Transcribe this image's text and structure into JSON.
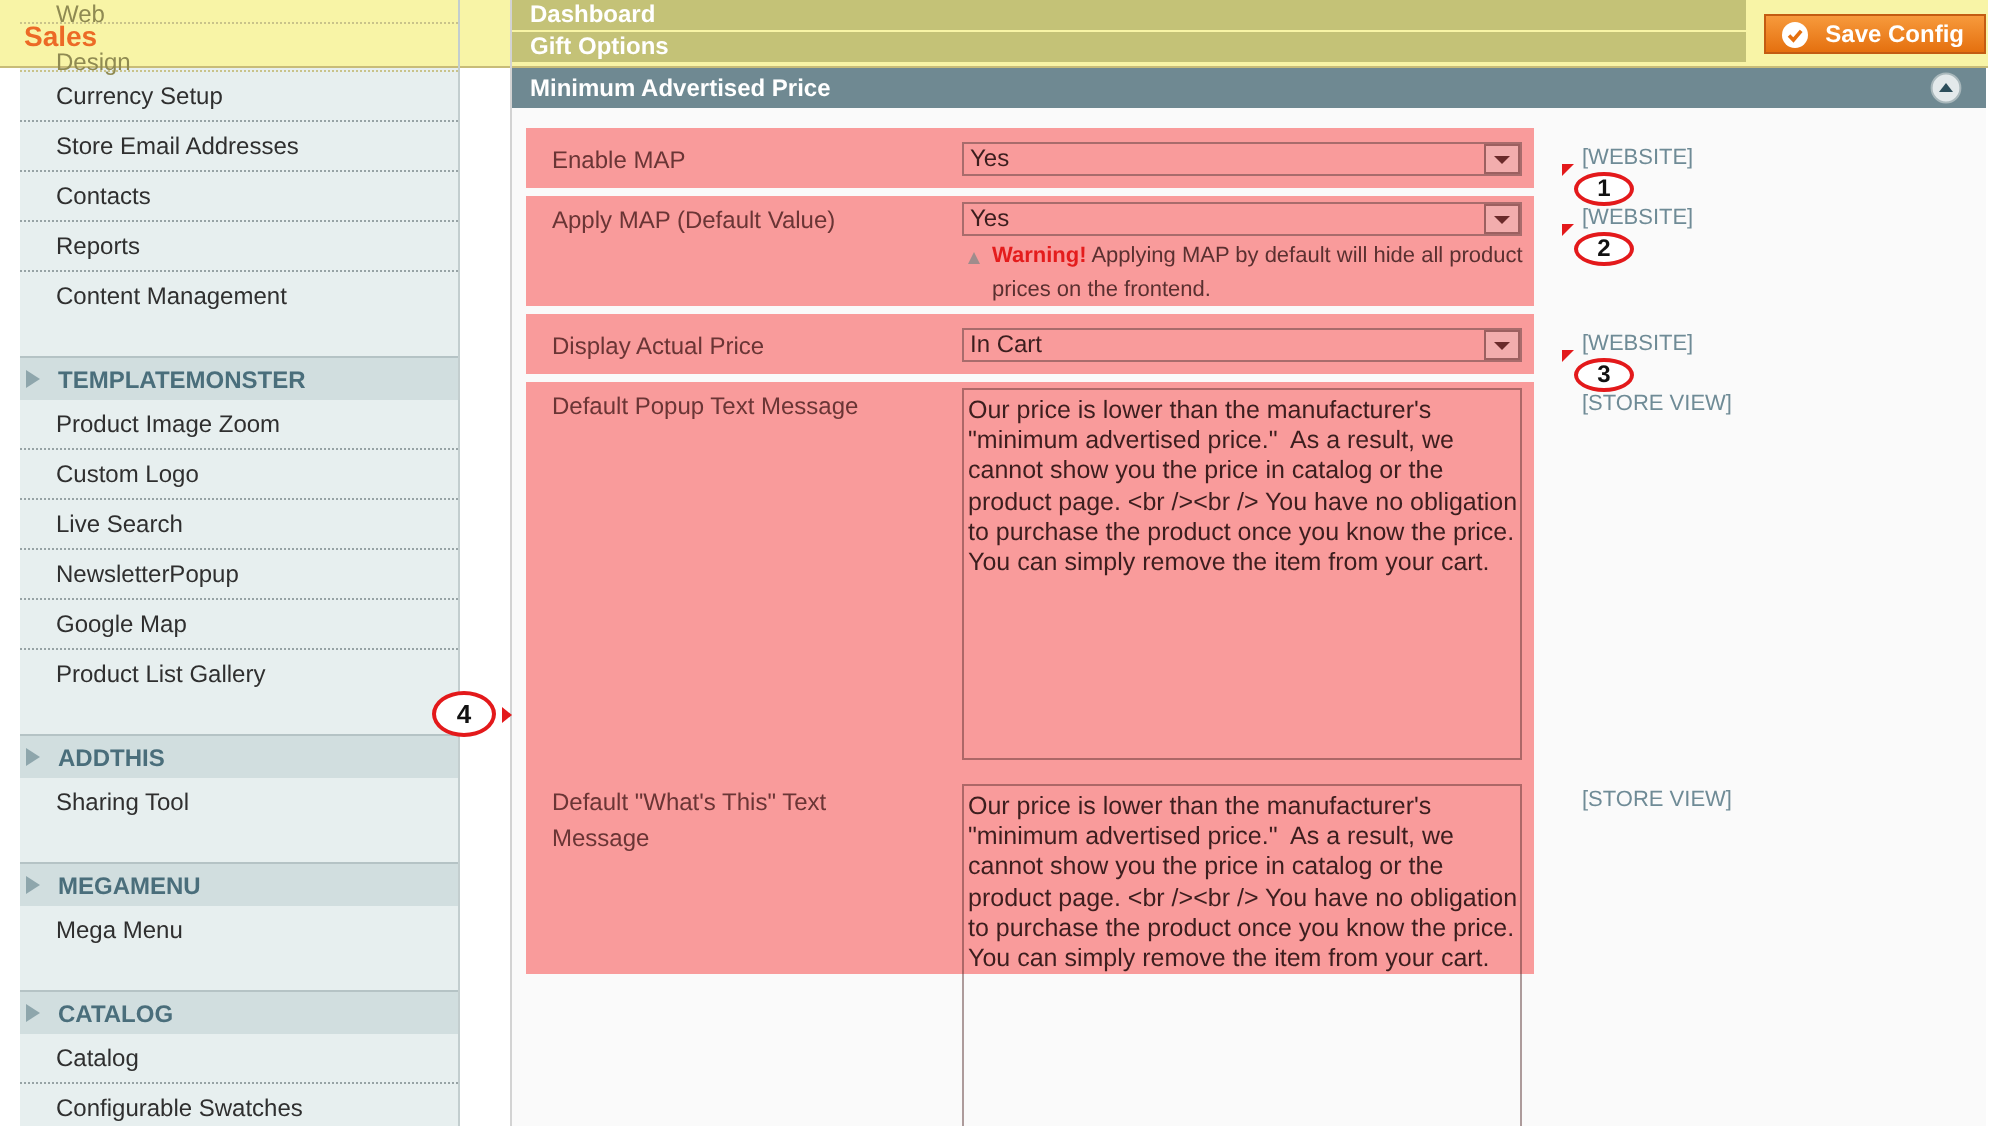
{
  "top_bar": {
    "label": "Sales",
    "save_button": "Save Config"
  },
  "sidebar": {
    "sections": [
      {
        "items": [
          "Web",
          "Design",
          "Currency Setup",
          "Store Email Addresses",
          "Contacts",
          "Reports",
          "Content Management"
        ]
      },
      {
        "title": "TEMPLATEMONSTER",
        "items": [
          "Product Image Zoom",
          "Custom Logo",
          "Live Search",
          "NewsletterPopup",
          "Google Map",
          "Product List Gallery"
        ]
      },
      {
        "title": "ADDTHIS",
        "items": [
          "Sharing Tool"
        ]
      },
      {
        "title": "MEGAMENU",
        "items": [
          "Mega Menu"
        ]
      },
      {
        "title": "CATALOG",
        "items": [
          "Catalog",
          "Configurable Swatches"
        ]
      }
    ]
  },
  "content": {
    "sections_above": [
      {
        "title": "Dashboard"
      },
      {
        "title": "Gift Options"
      }
    ],
    "fieldset": {
      "title": "Minimum Advertised Price",
      "expanded": true,
      "groups": [
        {
          "callout": {
            "number": "1",
            "kind": "flag"
          },
          "rows": [
            {
              "label": "Enable MAP",
              "kind": "select",
              "value": "Yes",
              "scope": "[WEBSITE]"
            }
          ]
        },
        {
          "callout": {
            "number": "2",
            "kind": "flag"
          },
          "rows": [
            {
              "label": "Apply MAP (Default Value)",
              "kind": "select",
              "value": "Yes",
              "note": "**Warning!** Applying MAP by default will hide all product prices on the frontend.",
              "scope": "[WEBSITE]"
            }
          ]
        },
        {
          "callout": {
            "number": "3",
            "kind": "flag"
          },
          "rows": [
            {
              "label": "Display Actual Price",
              "kind": "select",
              "value": "In Cart",
              "scope": "[WEBSITE]"
            }
          ]
        },
        {
          "callout": {
            "number": "4",
            "kind": "arrow"
          },
          "rows": [
            {
              "label": "Default Popup Text Message",
              "kind": "textarea",
              "value": "Our price is lower than the manufacturer's \"minimum advertised price.\"  As a result, we cannot show you the price in catalog or the product page. <br /><br /> You have no obligation to purchase the product once you know the price. You can simply remove the item from your cart.",
              "scope": "[STORE VIEW]"
            },
            {
              "label": "Default \"What's This\" Text Message",
              "kind": "textarea",
              "value": "Our price is lower than the manufacturer's \"minimum advertised price.\"  As a result, we cannot show you the price in catalog or the product page. <br /><br /> You have no obligation to purchase the product once you know the price. You can simply remove the item from your cart.",
              "scope": "[STORE VIEW]"
            }
          ]
        }
      ]
    }
  }
}
